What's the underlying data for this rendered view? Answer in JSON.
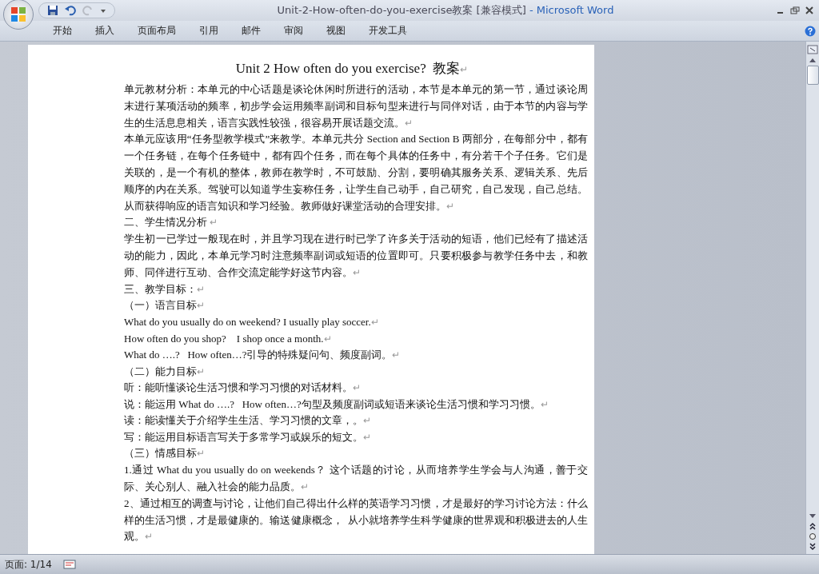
{
  "window": {
    "title": "Unit-2-How-often-do-you-exercise教案 [兼容模式]",
    "app_name": "- Microsoft Word"
  },
  "ribbon_tabs": [
    {
      "label": "开始",
      "selected": false
    },
    {
      "label": "插入",
      "selected": false
    },
    {
      "label": "页面布局",
      "selected": false
    },
    {
      "label": "引用",
      "selected": false
    },
    {
      "label": "邮件",
      "selected": false
    },
    {
      "label": "审阅",
      "selected": false
    },
    {
      "label": "视图",
      "selected": false
    },
    {
      "label": "开发工具",
      "selected": false
    }
  ],
  "document": {
    "paragraph_mark": "↵",
    "paragraphs": [
      {
        "kind": "title",
        "text": "Unit 2 How often do you exercise?  教案"
      },
      {
        "kind": "body",
        "text": "单元教材分析：本单元的中心话题是谈论休闲时所进行的活动，本节是本单元的第一节，通过谈论周末进行某项活动的频率，初步学会运用频率副词和目标句型来进行与同伴对话，由于本节的内容与学生的生活息息相关，语言实践性较强，很容易开展话题交流。"
      },
      {
        "kind": "body",
        "text": "本单元应该用“任务型教学模式”来教学。本单元共分 Section and Section B 两部分，在每部分中，都有一个任务链，在每个任务链中，都有四个任务，而在每个具体的任务中，有分若干个子任务。它们是关联的，是一个有机的整体，教师在教学时，不可鼓励、分割，要明确其服务关系、逻辑关系、先后顺序的内在关系。驾驶可以知道学生妄称任务，让学生自己动手，自己研究，自己发现，自己总结。从而获得响应的语言知识和学习经验。教师做好课堂活动的合理安排。"
      },
      {
        "kind": "body",
        "text": "二、学生情况分析 "
      },
      {
        "kind": "body",
        "text": "学生初一已学过一般现在时，并且学习现在进行时已学了许多关于活动的短语，他们已经有了描述活动的能力，因此，本单元学习时注意频率副词或短语的位置即可。只要积极参与教学任务中去，和教师、同伴进行互动、合作交流定能学好这节内容。"
      },
      {
        "kind": "body",
        "text": "三、教学目标："
      },
      {
        "kind": "body",
        "text": "（一）语言目标"
      },
      {
        "kind": "english",
        "text": "What do you usually do on weekend? I usually play soccer."
      },
      {
        "kind": "english",
        "text": "How often do you shop?    I shop once a month."
      },
      {
        "kind": "english",
        "text": "What do ….?   How often…?引导的特殊疑问句、频度副词。"
      },
      {
        "kind": "body",
        "text": "（二）能力目标"
      },
      {
        "kind": "english",
        "text": "听：能听懂谈论生活习惯和学习习惯的对话材料。"
      },
      {
        "kind": "english",
        "text": "说：能运用 What do ….?   How often…?句型及频度副词或短语来谈论生活习惯和学习习惯。"
      },
      {
        "kind": "english",
        "text": "读：能读懂关于介绍学生生活、学习习惯的文章，。"
      },
      {
        "kind": "english",
        "text": "写：能运用目标语言写关于多常学习或娱乐的短文。"
      },
      {
        "kind": "body",
        "text": "（三）情感目标"
      },
      {
        "kind": "body",
        "text": "1.通过 What du you usually do on weekends？ 这个话题的讨论，从而培养学生学会与人沟通，善于交际、关心别人、融入社会的能力品质。"
      },
      {
        "kind": "body",
        "text": "2、通过相互的调查与讨论，让他们自己得出什么样的英语学习习惯，才是最好的学习讨论方法：什么样的生活习惯，才是最健康的。输送健康概念，  从小就培养学生科学健康的世界观和积极进去的人生观。"
      }
    ]
  },
  "status_bar": {
    "page": "页面: 1/14"
  }
}
